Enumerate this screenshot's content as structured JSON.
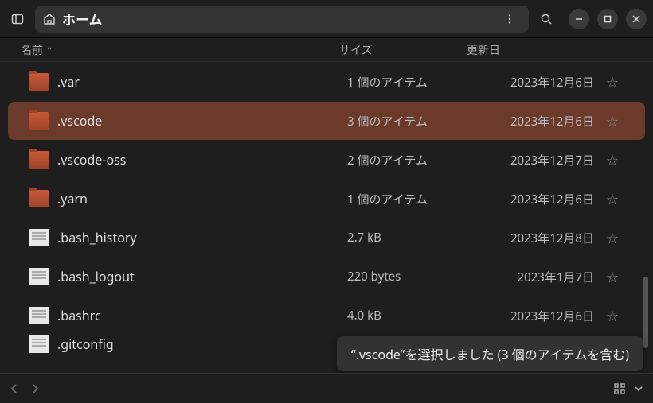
{
  "header": {
    "location_label": "ホーム"
  },
  "columns": {
    "name": "名前",
    "size": "サイズ",
    "date": "更新日"
  },
  "rows": [
    {
      "name": ".var",
      "size": "1 個のアイテム",
      "date": "2023年12月6日",
      "icon": "folder",
      "selected": false,
      "partial": false
    },
    {
      "name": ".vscode",
      "size": "3 個のアイテム",
      "date": "2023年12月6日",
      "icon": "folder",
      "selected": true,
      "partial": false
    },
    {
      "name": ".vscode-oss",
      "size": "2 個のアイテム",
      "date": "2023年12月7日",
      "icon": "folder",
      "selected": false,
      "partial": false
    },
    {
      "name": ".yarn",
      "size": "1 個のアイテム",
      "date": "2023年12月6日",
      "icon": "folder",
      "selected": false,
      "partial": false
    },
    {
      "name": ".bash_history",
      "size": "2.7 kB",
      "date": "2023年12月8日",
      "icon": "file",
      "selected": false,
      "partial": false
    },
    {
      "name": ".bash_logout",
      "size": "220 bytes",
      "date": "2023年1月7日",
      "icon": "file",
      "selected": false,
      "partial": false
    },
    {
      "name": ".bashrc",
      "size": "4.0 kB",
      "date": "2023年12月6日",
      "icon": "file",
      "selected": false,
      "partial": false
    },
    {
      "name": ".gitconfig",
      "size": "",
      "date": "",
      "icon": "file",
      "selected": false,
      "partial": "bottom"
    }
  ],
  "toast": "“.vscode”を選択しました (3 個のアイテムを含む)",
  "star_glyph": "☆"
}
